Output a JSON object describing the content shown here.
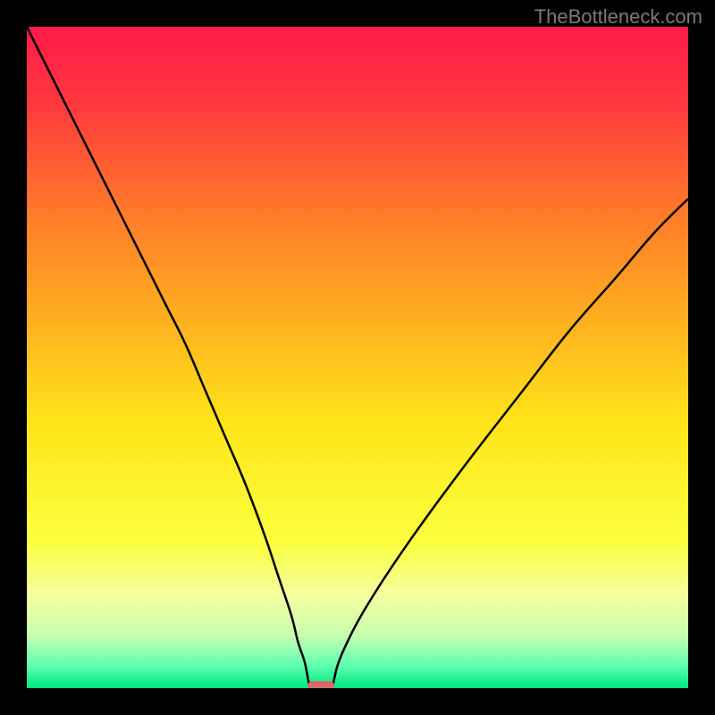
{
  "watermark": "TheBottleneck.com",
  "chart_data": {
    "type": "line",
    "title": "",
    "xlabel": "",
    "ylabel": "",
    "xlim": [
      0,
      100
    ],
    "ylim": [
      0,
      100
    ],
    "background_gradient": {
      "stops": [
        {
          "offset": 0.0,
          "color": "#ff1a4a"
        },
        {
          "offset": 0.12,
          "color": "#ff3a3f"
        },
        {
          "offset": 0.28,
          "color": "#ff7a2a"
        },
        {
          "offset": 0.45,
          "color": "#ffb220"
        },
        {
          "offset": 0.6,
          "color": "#ffe51a"
        },
        {
          "offset": 0.78,
          "color": "#fcff40"
        },
        {
          "offset": 0.86,
          "color": "#f4ffa0"
        },
        {
          "offset": 0.92,
          "color": "#c8ffb0"
        },
        {
          "offset": 0.965,
          "color": "#60ffb0"
        },
        {
          "offset": 1.0,
          "color": "#00e880"
        }
      ]
    },
    "series": [
      {
        "name": "left-curve",
        "x": [
          0,
          3,
          6,
          9,
          12,
          15,
          18,
          21,
          24,
          27,
          30,
          33,
          36,
          38,
          40,
          41,
          42,
          42.5,
          42.8
        ],
        "values": [
          100,
          94,
          88,
          82,
          76,
          70,
          64,
          58,
          52,
          45,
          38,
          31,
          23,
          17,
          11,
          7,
          4,
          1.5,
          0
        ]
      },
      {
        "name": "right-curve",
        "x": [
          46.2,
          46.5,
          47,
          48,
          50,
          53,
          57,
          62,
          68,
          75,
          82,
          89,
          95,
          100
        ],
        "values": [
          0,
          1.5,
          3.5,
          6,
          10,
          15,
          21,
          28,
          36,
          45,
          54,
          62,
          69,
          74
        ]
      }
    ],
    "marker": {
      "name": "minimum-marker",
      "x_center": 44.5,
      "y": 0,
      "width": 4,
      "color": "#d66a6a"
    }
  }
}
